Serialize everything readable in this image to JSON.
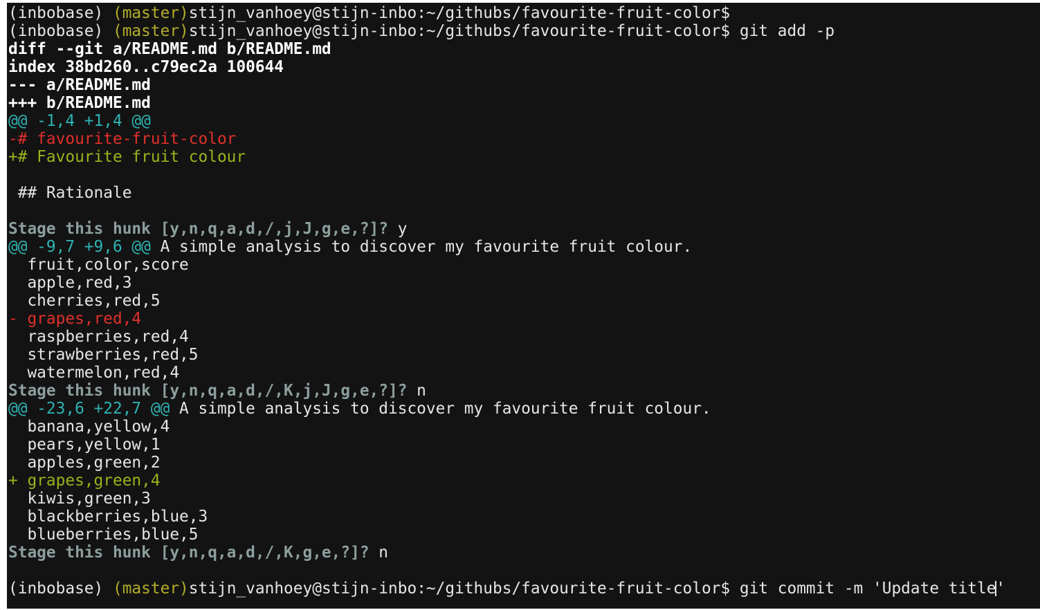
{
  "terminal": {
    "lines": [
      {
        "type": "shell",
        "env": "(inbobase) ",
        "branch": "(master)",
        "path": "stijn_vanhoey@stijn-inbo:~/githubs/favourite-fruit-color$",
        "cmd": ""
      },
      {
        "type": "shell",
        "env": "(inbobase) ",
        "branch": "(master)",
        "path": "stijn_vanhoey@stijn-inbo:~/githubs/favourite-fruit-color$",
        "cmd": " git add -p"
      },
      {
        "type": "meta",
        "text": "diff --git a/README.md b/README.md"
      },
      {
        "type": "meta",
        "text": "index 38bd260..c79ec2a 100644"
      },
      {
        "type": "meta",
        "text": "--- a/README.md"
      },
      {
        "type": "meta",
        "text": "+++ b/README.md"
      },
      {
        "type": "hunk",
        "header": "@@ -1,4 +1,4 @@",
        "context": ""
      },
      {
        "type": "del",
        "text": "-# favourite-fruit-color"
      },
      {
        "type": "add",
        "text": "+# Favourite fruit colour"
      },
      {
        "type": "plain",
        "text": " "
      },
      {
        "type": "plain",
        "text": " ## Rationale"
      },
      {
        "type": "plain",
        "text": ""
      },
      {
        "type": "prompt",
        "question": "Stage this hunk [y,n,q,a,d,/,j,J,g,e,?]?",
        "answer": " y"
      },
      {
        "type": "hunk",
        "header": "@@ -9,7 +9,6 @@",
        "context": " A simple analysis to discover my favourite fruit colour."
      },
      {
        "type": "plain",
        "text": "  fruit,color,score"
      },
      {
        "type": "plain",
        "text": "  apple,red,3"
      },
      {
        "type": "plain",
        "text": "  cherries,red,5"
      },
      {
        "type": "del",
        "text": "- grapes,red,4"
      },
      {
        "type": "plain",
        "text": "  raspberries,red,4"
      },
      {
        "type": "plain",
        "text": "  strawberries,red,5"
      },
      {
        "type": "plain",
        "text": "  watermelon,red,4"
      },
      {
        "type": "prompt",
        "question": "Stage this hunk [y,n,q,a,d,/,K,j,J,g,e,?]?",
        "answer": " n"
      },
      {
        "type": "hunk",
        "header": "@@ -23,6 +22,7 @@",
        "context": " A simple analysis to discover my favourite fruit colour."
      },
      {
        "type": "plain",
        "text": "  banana,yellow,4"
      },
      {
        "type": "plain",
        "text": "  pears,yellow,1"
      },
      {
        "type": "plain",
        "text": "  apples,green,2"
      },
      {
        "type": "add",
        "text": "+ grapes,green,4"
      },
      {
        "type": "plain",
        "text": "  kiwis,green,3"
      },
      {
        "type": "plain",
        "text": "  blackberries,blue,3"
      },
      {
        "type": "plain",
        "text": "  blueberries,blue,5"
      },
      {
        "type": "prompt",
        "question": "Stage this hunk [y,n,q,a,d,/,K,g,e,?]?",
        "answer": " n"
      },
      {
        "type": "plain",
        "text": ""
      },
      {
        "type": "shell",
        "env": "(inbobase) ",
        "branch": "(master)",
        "path": "stijn_vanhoey@stijn-inbo:~/githubs/favourite-fruit-color$",
        "cmd": " git commit -m 'Update title",
        "after_cursor": "'",
        "cursor": true
      }
    ]
  },
  "colors": {
    "background": "#131313",
    "text": "#e6e6e6",
    "branch": "#b3ad2b",
    "hunk_header": "#2fb3b3",
    "deleted": "#e0302b",
    "added": "#9ab41c",
    "prompt": "#8d9e9e"
  }
}
